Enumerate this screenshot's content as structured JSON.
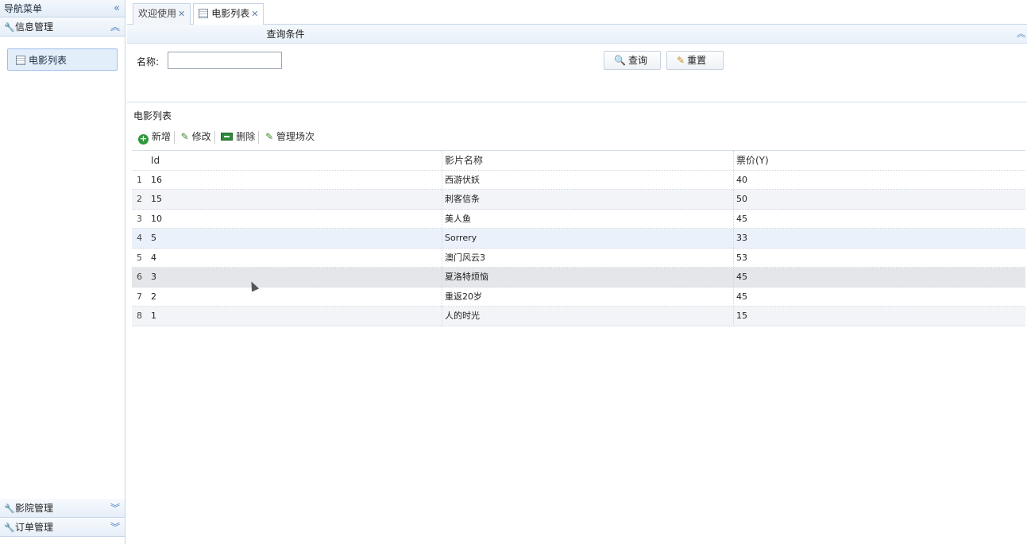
{
  "nav": {
    "title": "导航菜单",
    "collapse_icon": "double-chevron-left-icon",
    "sections": [
      {
        "label": "信息管理",
        "state": "expanded",
        "items": [
          {
            "label": "电影列表",
            "selected": true
          }
        ]
      },
      {
        "label": "影院管理",
        "state": "collapsed"
      },
      {
        "label": "订单管理",
        "state": "collapsed"
      }
    ]
  },
  "tabs": [
    {
      "label": "欢迎使用",
      "active": false
    },
    {
      "label": "电影列表",
      "active": true
    }
  ],
  "search": {
    "title": "查询条件",
    "name_label": "名称:",
    "name_value": "",
    "query_label": "查询",
    "reset_label": "重置"
  },
  "list": {
    "title": "电影列表",
    "toolbar": {
      "add": "新增",
      "edit": "修改",
      "delete": "删除",
      "schedule": "管理场次"
    },
    "columns": {
      "id": "Id",
      "name": "影片名称",
      "price": "票价(Y)"
    },
    "rows": [
      {
        "rn": "1",
        "id": "16",
        "name": "西游伏妖",
        "price": "40"
      },
      {
        "rn": "2",
        "id": "15",
        "name": "刺客信条",
        "price": "50"
      },
      {
        "rn": "3",
        "id": "10",
        "name": "美人鱼",
        "price": "45"
      },
      {
        "rn": "4",
        "id": "5",
        "name": "Sorrery",
        "price": "33"
      },
      {
        "rn": "5",
        "id": "4",
        "name": "澳门风云3",
        "price": "53"
      },
      {
        "rn": "6",
        "id": "3",
        "name": "夏洛特烦恼",
        "price": "45"
      },
      {
        "rn": "7",
        "id": "2",
        "name": "重返20岁",
        "price": "45"
      },
      {
        "rn": "8",
        "id": "1",
        "name": "人的时光",
        "price": "15"
      }
    ]
  },
  "colors": {
    "accent": "#4a7fc1",
    "border": "#c5d5e8",
    "selected_bg": "#e3eefb"
  }
}
